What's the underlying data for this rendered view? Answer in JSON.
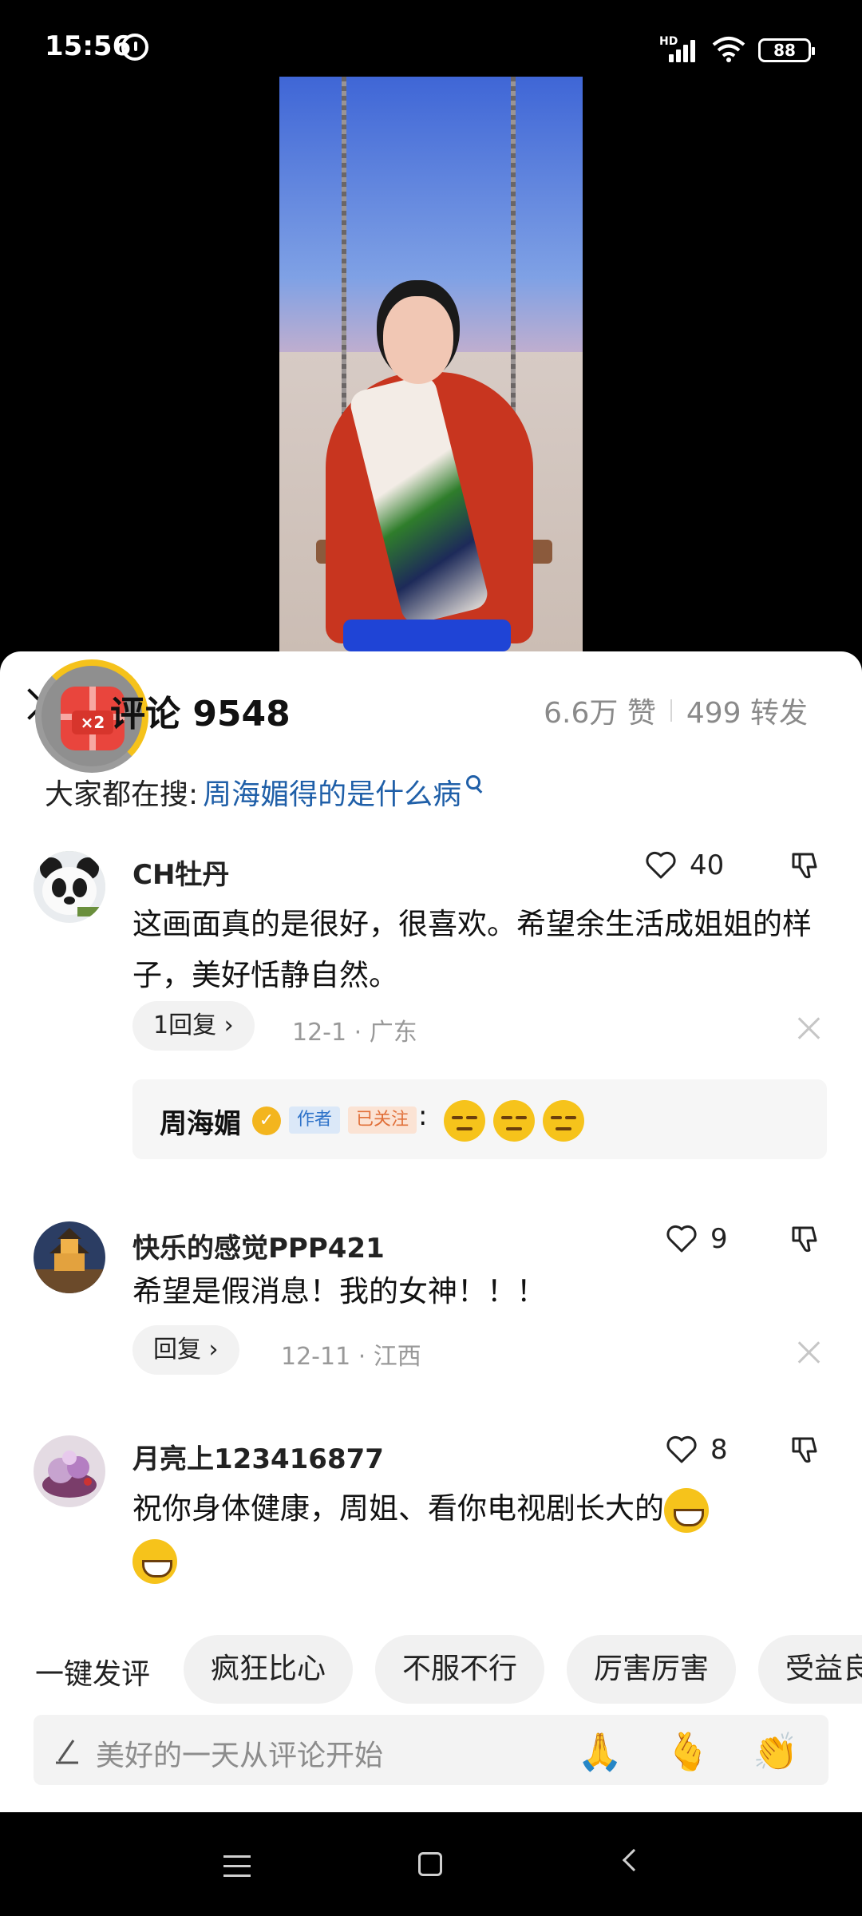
{
  "status": {
    "time": "15:56",
    "network": "HD",
    "battery": "88"
  },
  "comments_panel": {
    "title": "评论 9548",
    "likes": "6.6万 赞",
    "reposts": "499 转发",
    "search_prefix": "大家都在搜:",
    "search_term": "周海媚得的是什么病",
    "badge_text": "×2"
  },
  "comments": [
    {
      "user": "CH牡丹",
      "likes": "40",
      "text": "这画面真的是很好，很喜欢。希望余生活成姐姐的样子，美好恬静自然。",
      "reply": "1回复",
      "meta": "12-1 · 广东",
      "author_reply": {
        "name": "周海媚",
        "tag_author": "作者",
        "tag_follow": "已关注",
        "colon": ":"
      }
    },
    {
      "user": "快乐的感觉PPP421",
      "likes": "9",
      "text": "希望是假消息！我的女神！！！",
      "reply": "回复",
      "meta": "12-11 · 江西"
    },
    {
      "user": "月亮上123416877",
      "likes": "8",
      "text": "祝你身体健康，周姐、看你电视剧长大的"
    }
  ],
  "quick_comment": {
    "label": "一键发评",
    "chips": [
      "疯狂比心",
      "不服不行",
      "厉害厉害",
      "受益良"
    ]
  },
  "input": {
    "placeholder": "美好的一天从评论开始"
  },
  "emojis": [
    "🙏",
    "🫰",
    "👏"
  ]
}
